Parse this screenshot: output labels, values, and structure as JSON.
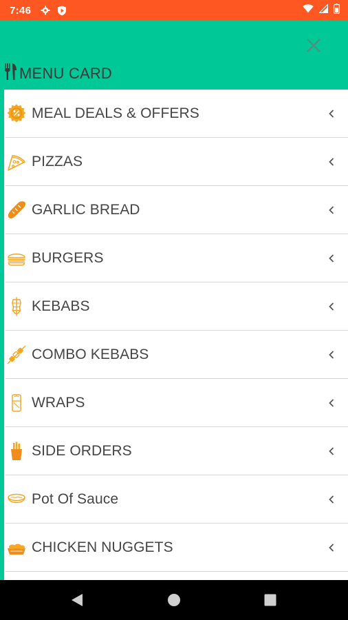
{
  "status_bar": {
    "time": "7:46",
    "left_icons": [
      "gear-icon",
      "shield-play-icon"
    ],
    "right_icons": [
      "wifi-icon",
      "signal-icon",
      "battery-icon"
    ],
    "background": "#FF5722"
  },
  "header": {
    "title": "MENU CARD",
    "title_icon": "fork-knife-icon",
    "close_icon": "close-icon",
    "background": "#00C896"
  },
  "menu": {
    "accent_color": "#00C896",
    "icon_color": "#F5A623",
    "items": [
      {
        "label": "MEAL DEALS & OFFERS",
        "icon": "offer-badge-icon"
      },
      {
        "label": "PIZZAS",
        "icon": "pizza-slice-icon"
      },
      {
        "label": "GARLIC BREAD",
        "icon": "baguette-icon"
      },
      {
        "label": "BURGERS",
        "icon": "burger-icon"
      },
      {
        "label": "KEBABS",
        "icon": "kebab-icon"
      },
      {
        "label": "COMBO KEBABS",
        "icon": "skewer-icon"
      },
      {
        "label": "WRAPS",
        "icon": "wrap-icon"
      },
      {
        "label": "SIDE ORDERS",
        "icon": "fries-icon"
      },
      {
        "label": "Pot Of Sauce",
        "icon": "sauce-pot-icon"
      },
      {
        "label": "CHICKEN NUGGETS",
        "icon": "nuggets-icon"
      }
    ]
  },
  "nav_bar": {
    "buttons": [
      "back-icon",
      "home-icon",
      "recents-icon"
    ]
  }
}
